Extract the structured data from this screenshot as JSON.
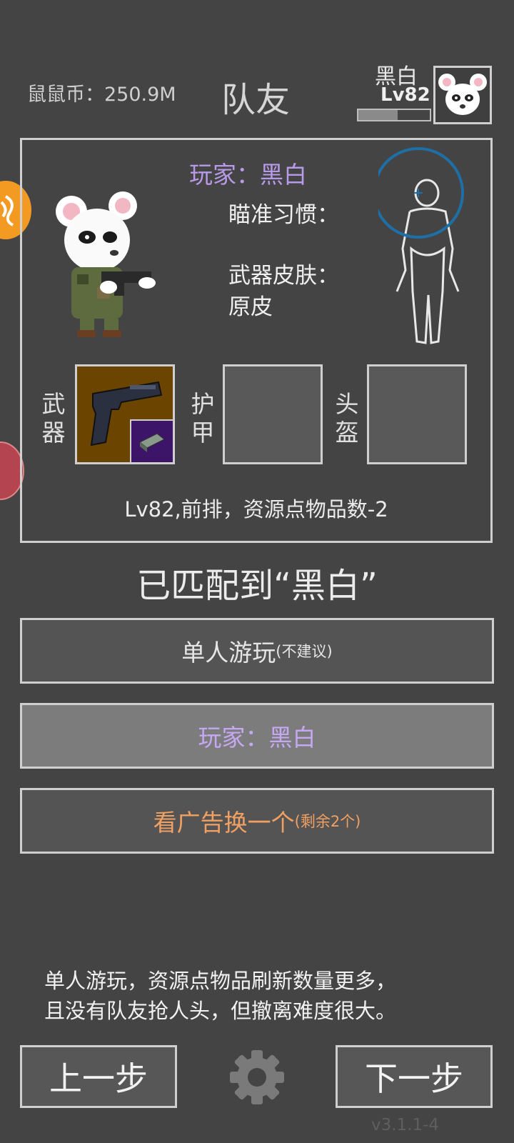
{
  "header": {
    "coins_label": "鼠鼠币：",
    "coins_value": "250.9M",
    "title": "队友",
    "player_name": "黑白",
    "player_level": "Lv82",
    "xp_progress": 0.55
  },
  "teammate": {
    "player_line": "玩家：黑白",
    "aim_label": "瞄准习惯：",
    "skin_label": "武器皮肤：",
    "skin_value": "原皮",
    "slots": {
      "weapon_label": "武器",
      "armor_label": "护甲",
      "helmet_label": "头盔"
    },
    "info": "Lv82,前排，资源点物品数-2"
  },
  "matched_text": "已匹配到“黑白”",
  "options": {
    "solo_main": "单人游玩",
    "solo_sub": "(不建议)",
    "player_button": "玩家：黑白",
    "ad_main": "看广告换一个",
    "ad_sub": "(剩余2个)"
  },
  "description": {
    "line1": "单人游玩，资源点物品刷新数量更多，",
    "line2": "且没有队友抢人头，但撤离难度很大。"
  },
  "nav": {
    "prev": "上一步",
    "next": "下一步"
  },
  "version": "v3.1.1-4",
  "colors": {
    "background": "#444444",
    "purple_text": "#b89ae8",
    "orange_text": "#f0a062",
    "weapon_slot_bg": "#6b4400"
  },
  "icons": {
    "settings": "gear-icon",
    "avatar": "panda-mouse-avatar",
    "body_target": "body-silhouette-icon"
  }
}
